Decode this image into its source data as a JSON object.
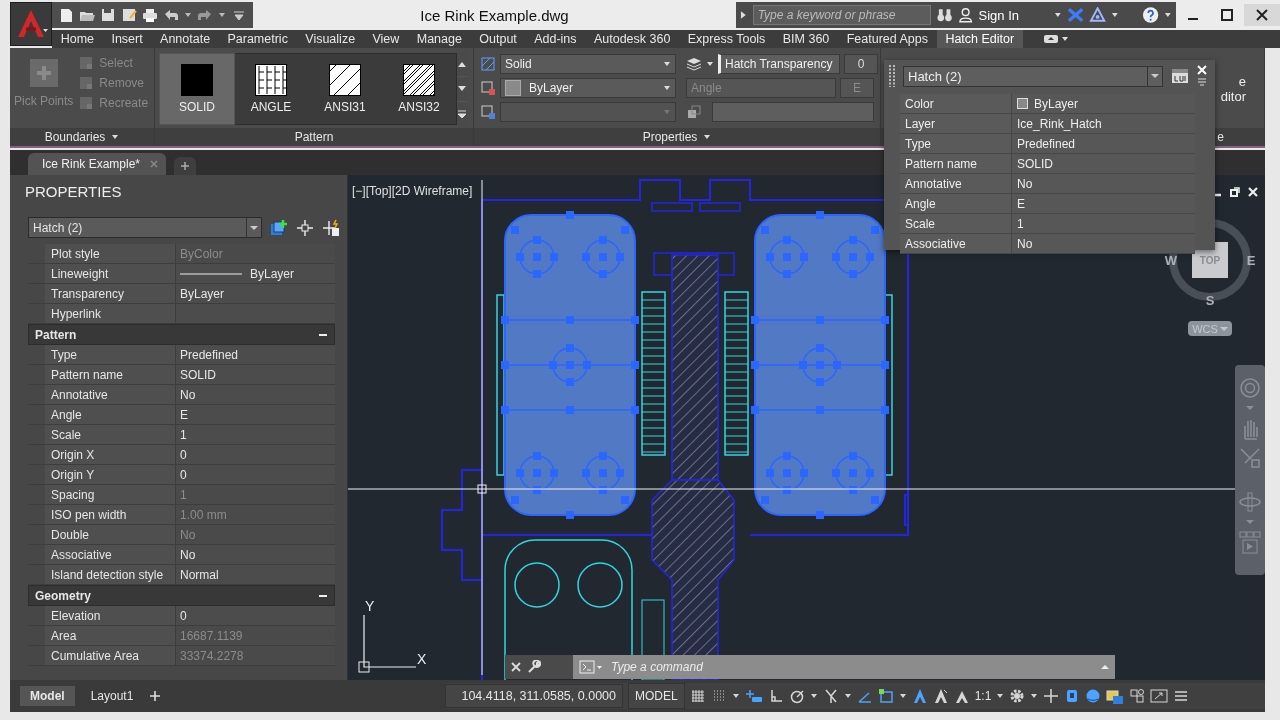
{
  "title_bar": {
    "title": "Ice Rink Example.dwg",
    "search": {
      "placeholder": "Type a keyword or phrase"
    },
    "sign_in": "Sign In"
  },
  "ribbon_tabs": [
    {
      "label": "Home",
      "selected": false
    },
    {
      "label": "Insert",
      "selected": false
    },
    {
      "label": "Annotate",
      "selected": false
    },
    {
      "label": "Parametric",
      "selected": false
    },
    {
      "label": "Visualize",
      "selected": false
    },
    {
      "label": "View",
      "selected": false
    },
    {
      "label": "Manage",
      "selected": false
    },
    {
      "label": "Output",
      "selected": false
    },
    {
      "label": "Add-ins",
      "selected": false
    },
    {
      "label": "Autodesk 360",
      "selected": false
    },
    {
      "label": "Express Tools",
      "selected": false
    },
    {
      "label": "BIM 360",
      "selected": false
    },
    {
      "label": "Featured Apps",
      "selected": false
    },
    {
      "label": "Hatch Editor",
      "selected": true
    }
  ],
  "ribbon": {
    "boundaries": {
      "title": "Boundaries",
      "pick_points": {
        "label": "Pick Points",
        "disabled": true
      },
      "tools": [
        {
          "label": "Select",
          "disabled": true
        },
        {
          "label": "Remove",
          "disabled": true
        },
        {
          "label": "Recreate",
          "disabled": true
        }
      ]
    },
    "pattern": {
      "title": "Pattern",
      "items": [
        {
          "label": "SOLID",
          "kind": "solid",
          "selected": true
        },
        {
          "label": "ANGLE",
          "kind": "angle",
          "selected": false
        },
        {
          "label": "ANSI31",
          "kind": "ansi31",
          "selected": false
        },
        {
          "label": "ANSI32",
          "kind": "ansi32",
          "selected": false
        }
      ]
    },
    "properties": {
      "title": "Properties",
      "hatch_type": "Solid",
      "hatch_color": "ByLayer",
      "transparency": {
        "label": "Hatch Transparency",
        "value": "0"
      },
      "angle": {
        "label": "Angle",
        "value": "E",
        "disabled": true
      }
    },
    "close_panel": {
      "label_lines": [
        "e",
        "ditor"
      ],
      "title": "e"
    }
  },
  "file_tabs": [
    {
      "label": "Ice Rink Example*",
      "selected": true
    }
  ],
  "properties_palette": {
    "title": "PROPERTIES",
    "selection": "Hatch (2)",
    "sections": [
      {
        "rows": [
          {
            "label": "Plot style",
            "value": "ByColor",
            "kind": "text",
            "disabled": true
          },
          {
            "label": "Lineweight",
            "value": "ByLayer",
            "kind": "lineweight",
            "disabled": false
          },
          {
            "label": "Transparency",
            "value": "ByLayer",
            "kind": "text",
            "disabled": false
          },
          {
            "label": "Hyperlink",
            "kind": "text"
          }
        ]
      },
      {
        "title": "Pattern",
        "expanded": true,
        "rows": [
          {
            "label": "Type",
            "value": "Predefined",
            "kind": "text",
            "disabled": false
          },
          {
            "label": "Pattern name",
            "value": "SOLID",
            "kind": "text",
            "disabled": false
          },
          {
            "label": "Annotative",
            "value": "No",
            "kind": "text",
            "disabled": false
          },
          {
            "label": "Angle",
            "value": "E",
            "kind": "text",
            "disabled": false
          },
          {
            "label": "Scale",
            "value": "1",
            "kind": "text",
            "disabled": false
          },
          {
            "label": "Origin X",
            "value": "0",
            "kind": "text",
            "disabled": false
          },
          {
            "label": "Origin Y",
            "value": "0",
            "kind": "text",
            "disabled": false
          },
          {
            "label": "Spacing",
            "value": "1",
            "kind": "text",
            "disabled": true
          },
          {
            "label": "ISO pen width",
            "value": "1.00 mm",
            "kind": "text",
            "disabled": true
          },
          {
            "label": "Double",
            "value": "No",
            "kind": "text",
            "disabled": true
          },
          {
            "label": "Associative",
            "value": "No",
            "kind": "text",
            "disabled": false
          },
          {
            "label": "Island detection style",
            "value": "Normal",
            "kind": "text",
            "disabled": false
          }
        ]
      },
      {
        "title": "Geometry",
        "expanded": true,
        "rows": [
          {
            "label": "Elevation",
            "value": "0",
            "kind": "text",
            "disabled": false
          },
          {
            "label": "Area",
            "value": "16687.1139",
            "kind": "text",
            "disabled": true
          },
          {
            "label": "Cumulative Area",
            "value": "33374.2278",
            "kind": "text",
            "disabled": true
          }
        ]
      }
    ]
  },
  "viewport": {
    "label": "[−][Top][2D Wireframe]",
    "viewcube": {
      "face": "TOP",
      "west": "W",
      "east": "E",
      "south": "S"
    },
    "ucs_menu": "WCS",
    "axes": {
      "x": "X",
      "y": "Y"
    }
  },
  "quick_properties": {
    "selection": "Hatch (2)",
    "rows": [
      {
        "label": "Color",
        "value": "ByLayer",
        "kind": "color"
      },
      {
        "label": "Layer",
        "value": "Ice_Rink_Hatch",
        "kind": "text"
      },
      {
        "label": "Type",
        "value": "Predefined",
        "kind": "text"
      },
      {
        "label": "Pattern name",
        "value": "SOLID",
        "kind": "text"
      },
      {
        "label": "Annotative",
        "value": "No",
        "kind": "text"
      },
      {
        "label": "Angle",
        "value": "E",
        "kind": "text"
      },
      {
        "label": "Scale",
        "value": "1",
        "kind": "text"
      },
      {
        "label": "Associative",
        "value": "No",
        "kind": "text"
      }
    ]
  },
  "command_line": {
    "placeholder": "Type a command"
  },
  "layout_tabs": [
    {
      "label": "Model",
      "selected": true
    },
    {
      "label": "Layout1",
      "selected": false
    }
  ],
  "status_bar": {
    "coordinates": "104.4118, 311.0585, 0.0000",
    "space": "MODEL",
    "icons_left": [
      {
        "kind": "grid",
        "on": false
      },
      {
        "kind": "snap",
        "on": false
      },
      {
        "kind": "caret",
        "on": false
      },
      {
        "kind": "infer",
        "on": true
      },
      {
        "kind": "ortho",
        "on": false
      },
      {
        "kind": "polar",
        "on": false
      },
      {
        "kind": "caret",
        "on": false
      },
      {
        "kind": "isodraft",
        "on": false
      },
      {
        "kind": "caret",
        "on": false
      },
      {
        "kind": "dynucs",
        "on": true
      },
      {
        "kind": "osnap",
        "on": true
      },
      {
        "kind": "caret",
        "on": false
      },
      {
        "kind": "annomonitor",
        "on": true
      },
      {
        "kind": "annovis",
        "on": false
      },
      {
        "kind": "autoscale",
        "on": false
      }
    ],
    "scale": "1:1",
    "icons_right": [
      {
        "kind": "caret",
        "on": false
      },
      {
        "kind": "gear",
        "on": false
      },
      {
        "kind": "caret",
        "on": false
      },
      {
        "kind": "plus",
        "on": false
      },
      {
        "kind": "lock",
        "on": true
      },
      {
        "kind": "isolate",
        "on": true
      },
      {
        "kind": "hardware",
        "on": false
      },
      {
        "kind": "clean",
        "on": false
      },
      {
        "kind": "fullscreen",
        "on": false
      },
      {
        "kind": "customize",
        "on": false
      }
    ]
  }
}
